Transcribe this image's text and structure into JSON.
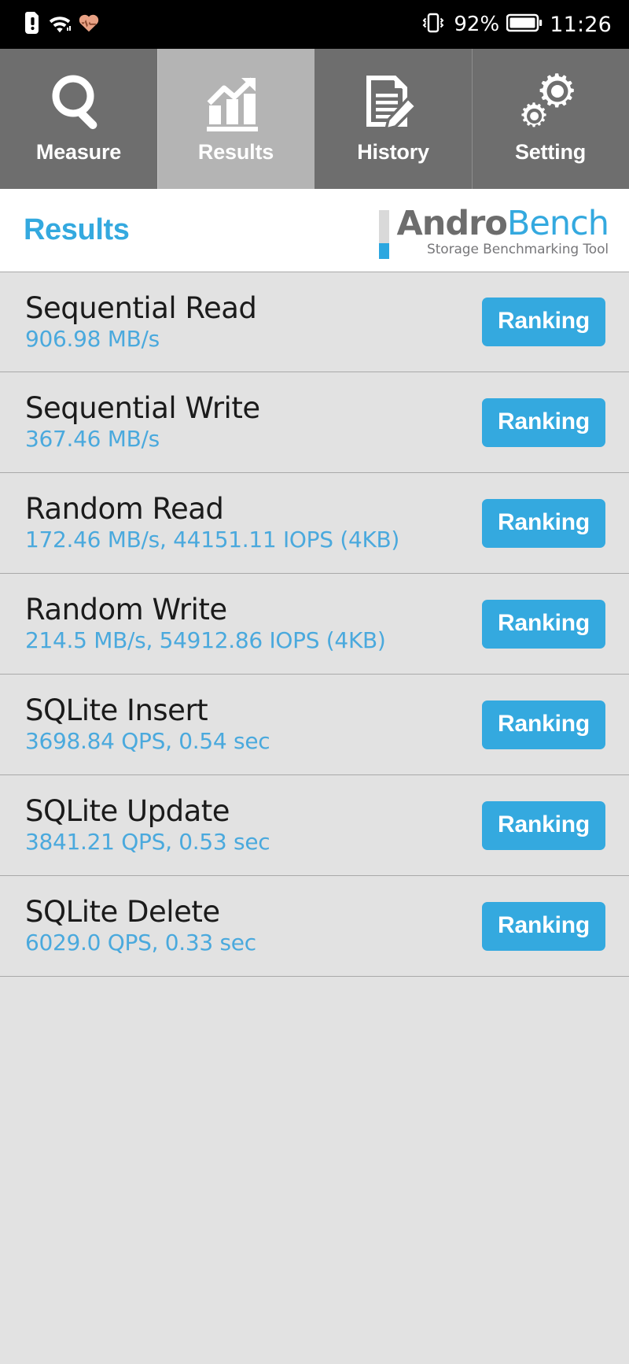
{
  "statusbar": {
    "time": "11:26",
    "battery_percent": "92%",
    "icons_left": [
      "sdcard-alert-icon",
      "wifi-icon",
      "heart-rate-icon"
    ],
    "icons_right": [
      "vibrate-icon",
      "battery-icon"
    ]
  },
  "tabs": [
    {
      "label": "Measure",
      "icon": "magnifier-icon",
      "active": false
    },
    {
      "label": "Results",
      "icon": "bar-chart-icon",
      "active": true
    },
    {
      "label": "History",
      "icon": "document-pencil-icon",
      "active": false
    },
    {
      "label": "Setting",
      "icon": "gears-icon",
      "active": false
    }
  ],
  "header": {
    "title": "Results",
    "brand_first": "Andro",
    "brand_second": "Bench",
    "brand_tagline": "Storage Benchmarking Tool"
  },
  "colors": {
    "accent": "#34a9df",
    "value_text": "#4aa9dd",
    "tab_inactive_bg": "#6e6e6e",
    "tab_active_bg": "#b4b4b4",
    "list_bg": "#e2e2e2"
  },
  "results": [
    {
      "name": "Sequential Read",
      "value": "906.98 MB/s",
      "button": "Ranking"
    },
    {
      "name": "Sequential Write",
      "value": "367.46 MB/s",
      "button": "Ranking"
    },
    {
      "name": "Random Read",
      "value": "172.46 MB/s, 44151.11 IOPS (4KB)",
      "button": "Ranking"
    },
    {
      "name": "Random Write",
      "value": "214.5 MB/s, 54912.86 IOPS (4KB)",
      "button": "Ranking"
    },
    {
      "name": "SQLite Insert",
      "value": "3698.84 QPS, 0.54 sec",
      "button": "Ranking"
    },
    {
      "name": "SQLite Update",
      "value": "3841.21 QPS, 0.53 sec",
      "button": "Ranking"
    },
    {
      "name": "SQLite Delete",
      "value": "6029.0 QPS, 0.33 sec",
      "button": "Ranking"
    }
  ]
}
